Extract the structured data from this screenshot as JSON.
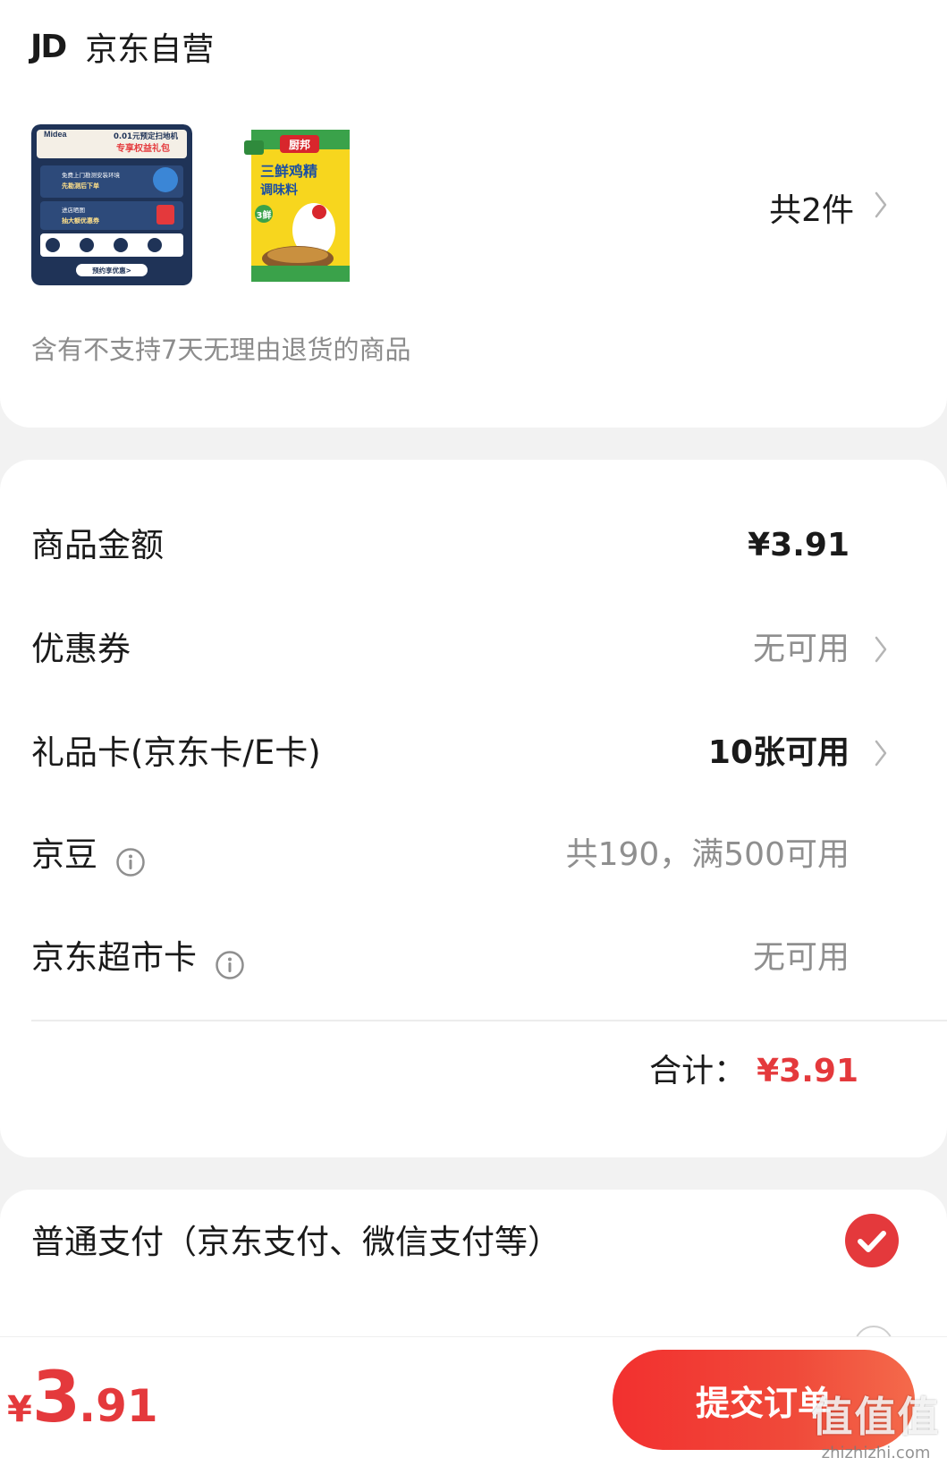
{
  "shop": {
    "logo": "JD",
    "name": "京东自营",
    "products": [
      {
        "name": "midea-product-card",
        "brand": "Midea",
        "headline": "0.01元预定扫地机",
        "subhead": "专享权益礼包",
        "line1": "免费上门勘测安装环境",
        "line1b": "先勘测后下单",
        "line2": "进店晒图",
        "line2b": "抽大额优惠券",
        "cta": "预约享优惠>"
      },
      {
        "name": "chubang-chicken-essence",
        "brand": "厨邦",
        "title": "三鲜鸡精",
        "subtitle": "调味料",
        "badge": "3鲜"
      }
    ],
    "count": "共2件",
    "notice": "含有不支持7天无理由退货的商品"
  },
  "price": {
    "goods_amount_label": "商品金额",
    "goods_amount": "¥3.91",
    "coupon_label": "优惠券",
    "coupon_value": "无可用",
    "giftcard_label": "礼品卡(京东卡/E卡)",
    "giftcard_value": "10张可用",
    "jingdou_label": "京豆",
    "jingdou_value": "共190，满500可用",
    "supermarket_label": "京东超市卡",
    "supermarket_value": "无可用",
    "total_label": "合计：",
    "total_amount": "¥3.91"
  },
  "payment": {
    "method_label": "普通支付（京东支付、微信支付等）",
    "selected": true
  },
  "bottom": {
    "currency": "¥",
    "amount_int": "3",
    "amount_dec": ".91",
    "submit_label": "提交订单"
  },
  "watermark": {
    "main": "值值值",
    "sub": "zhizhizhi.com"
  },
  "colors": {
    "accent": "#e4393c",
    "text": "#1a1a1a",
    "muted": "#8f8f8f",
    "background": "#f2f2f2"
  }
}
